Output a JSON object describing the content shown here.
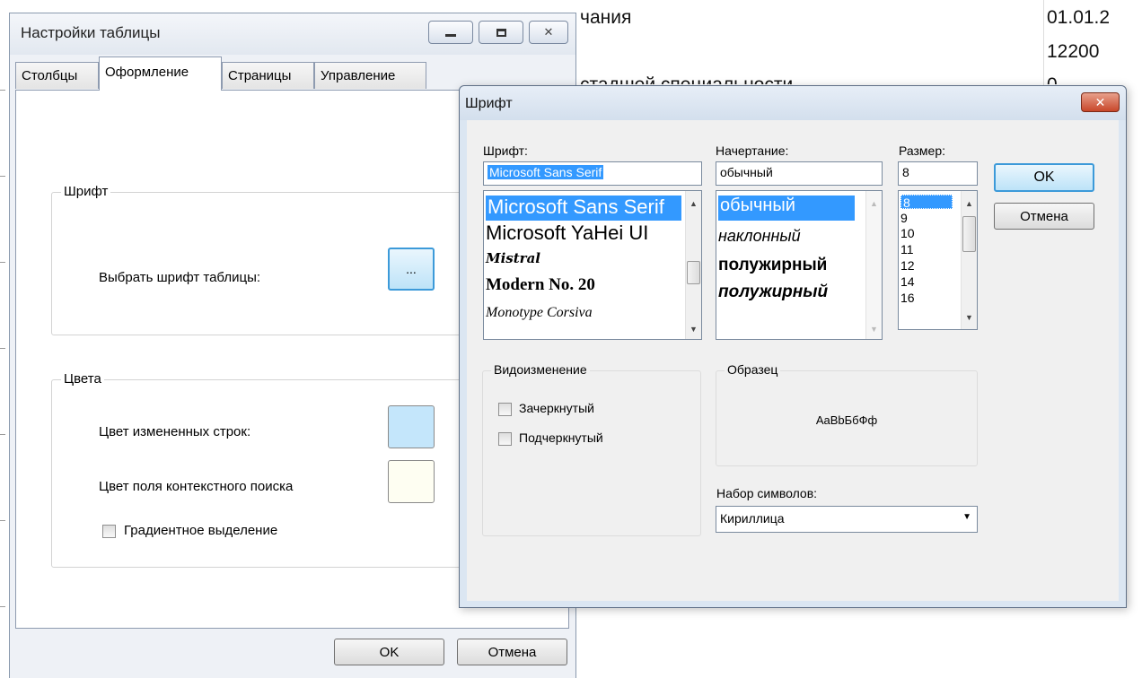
{
  "background": {
    "row1": "чания",
    "row2": "стадшей специальности",
    "col_right_1": "01.01.2",
    "col_right_2": "12200",
    "col_right_3": "0"
  },
  "table_settings": {
    "title": "Настройки таблицы",
    "tabs": [
      "Столбцы",
      "Оформление",
      "Страницы",
      "Управление"
    ],
    "active_tab": "Оформление",
    "font_group": {
      "legend": "Шрифт",
      "choose_label": "Выбрать шрифт таблицы:",
      "choose_button": "..."
    },
    "colors_group": {
      "legend": "Цвета",
      "changed_rows_label": "Цвет измененных строк:",
      "changed_rows_color": "#c4e6fb",
      "search_field_label": "Цвет поля контекстного поиска",
      "search_field_color": "#fefef2",
      "gradient_label": "Градиентное выделение"
    },
    "ok": "OK",
    "cancel": "Отмена"
  },
  "font_dialog": {
    "title": "Шрифт",
    "font_label": "Шрифт:",
    "font_value": "Microsoft Sans Serif",
    "fonts": [
      "Microsoft Sans Serif",
      "Microsoft YaHei UI",
      "Mistral",
      "Modern No. 20",
      "Monotype Corsiva"
    ],
    "style_label": "Начертание:",
    "style_value": "обычный",
    "styles": [
      "обычный",
      "наклонный",
      "полужирный",
      "полужирный"
    ],
    "size_label": "Размер:",
    "size_value": "8",
    "sizes": [
      "8",
      "9",
      "10",
      "11",
      "12",
      "14",
      "16"
    ],
    "ok": "OK",
    "cancel": "Отмена",
    "effects_legend": "Видоизменение",
    "strikeout": "Зачеркнутый",
    "underline": "Подчеркнутый",
    "sample_legend": "Образец",
    "sample_text": "AaBbБбФф",
    "charset_label": "Набор символов:",
    "charset_value": "Кириллица"
  }
}
